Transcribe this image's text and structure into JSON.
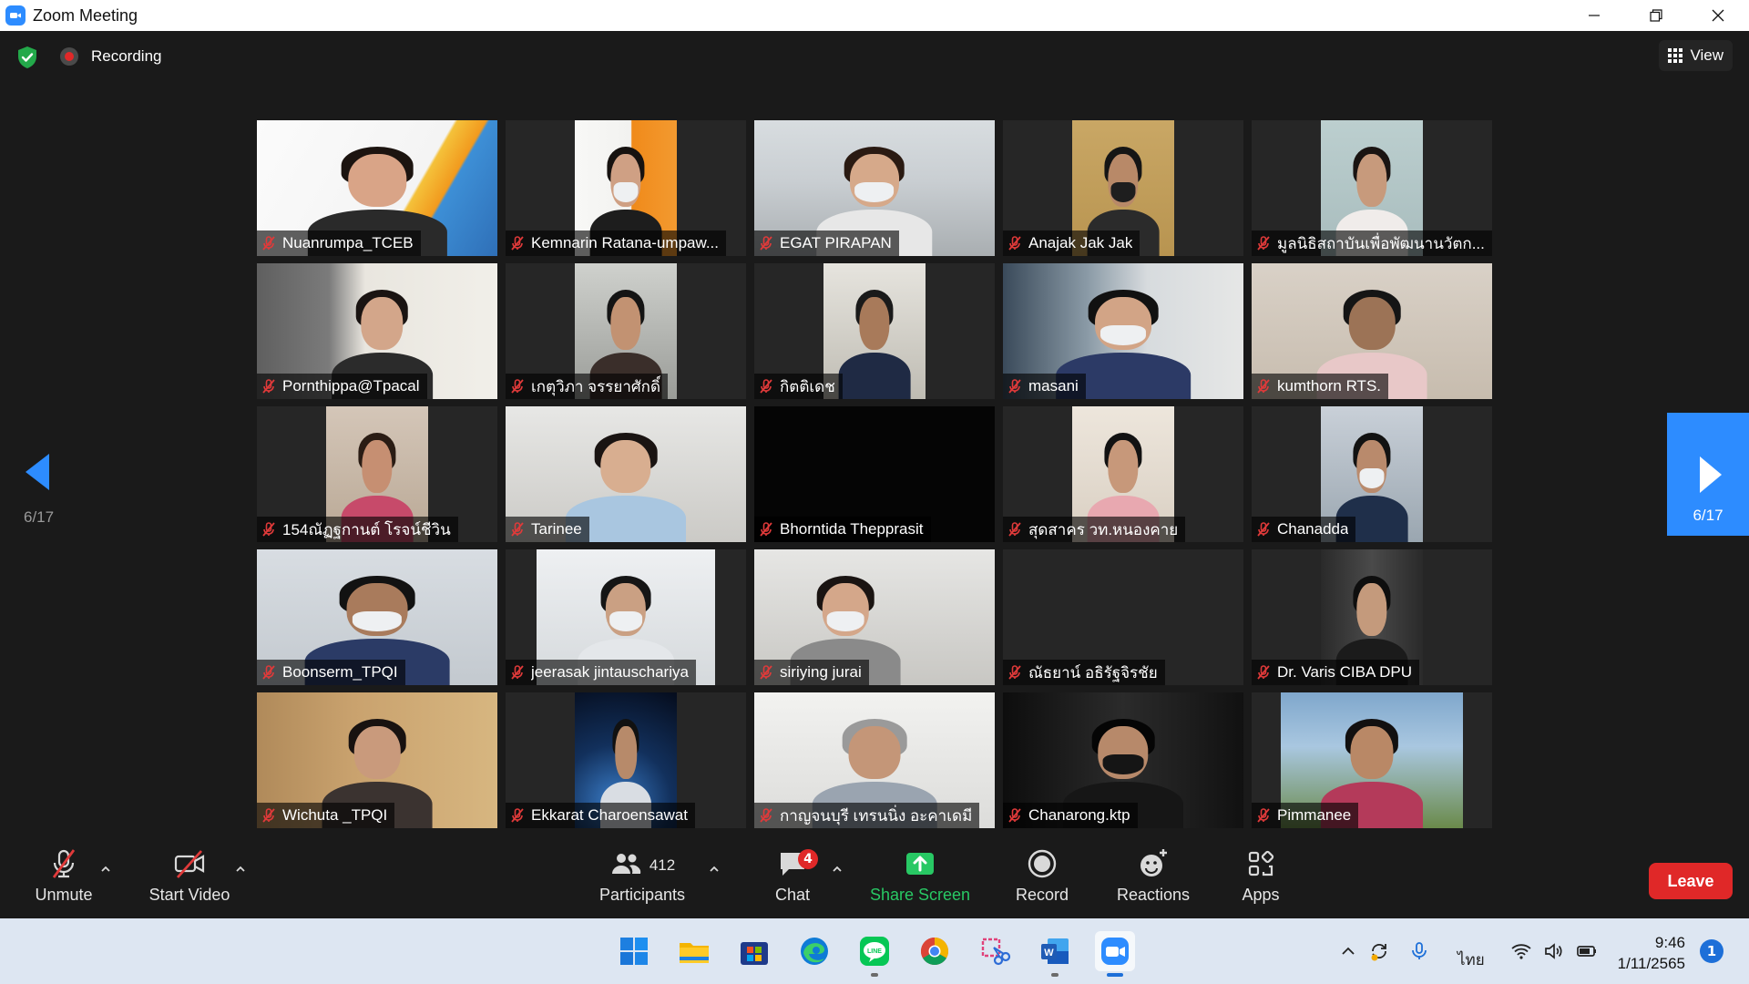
{
  "window": {
    "title": "Zoom Meeting"
  },
  "topbar": {
    "recording_label": "Recording",
    "view_label": "View"
  },
  "pages": {
    "prev_label": "6/17",
    "next_label": "6/17"
  },
  "participants_tiles": [
    {
      "name": "Nuanrumpa_TCEB",
      "muted": true
    },
    {
      "name": "Kemnarin Ratana-umpaw...",
      "muted": true
    },
    {
      "name": "EGAT PIRAPAN",
      "muted": true
    },
    {
      "name": "Anajak Jak Jak",
      "muted": true
    },
    {
      "name": "มูลนิธิสถาบันเพื่อพัฒนานวัตก...",
      "muted": true
    },
    {
      "name": "Pornthippa@Tpacal",
      "muted": true
    },
    {
      "name": "เกตุวิภา จรรยาศักดิ์",
      "muted": true
    },
    {
      "name": "กิตติเดช",
      "muted": true
    },
    {
      "name": "masani",
      "muted": true
    },
    {
      "name": "kumthorn RTS.",
      "muted": true
    },
    {
      "name": "154ณัฏฐกานต์ โรจน์ชีวิน",
      "muted": true
    },
    {
      "name": "Tarinee",
      "muted": true
    },
    {
      "name": "Bhorntida Thepprasit",
      "muted": true
    },
    {
      "name": "สุดสาคร วท.หนองคาย",
      "muted": true
    },
    {
      "name": "Chanadda",
      "muted": true
    },
    {
      "name": "Boonserm_TPQI",
      "muted": true
    },
    {
      "name": "jeerasak jintauschariya",
      "muted": true
    },
    {
      "name": "siriying jurai",
      "muted": true
    },
    {
      "name": "ณัธยาน์ อธิรัฐจิรชัย",
      "muted": true
    },
    {
      "name": "Dr. Varis CIBA DPU",
      "muted": true
    },
    {
      "name": "Wichuta _TPQI",
      "muted": true
    },
    {
      "name": "Ekkarat Charoensawat",
      "muted": true
    },
    {
      "name": "กาญจนบุรี เทรนนิ่ง อะคาเดมี",
      "muted": true
    },
    {
      "name": "Chanarong.ktp",
      "muted": true
    },
    {
      "name": "Pimmanee",
      "muted": true
    }
  ],
  "toolbar": {
    "unmute": "Unmute",
    "start_video": "Start Video",
    "participants": "Participants",
    "participants_count": "412",
    "chat": "Chat",
    "chat_badge": "4",
    "share_screen": "Share Screen",
    "record": "Record",
    "reactions": "Reactions",
    "apps": "Apps",
    "leave": "Leave"
  },
  "taskbar": {
    "apps": [
      "start-icon",
      "file-explorer-icon",
      "microsoft-store-icon",
      "edge-icon",
      "line-icon",
      "chrome-icon",
      "snipping-tool-icon",
      "word-icon",
      "zoom-icon"
    ],
    "language": "ไทย",
    "time": "9:46",
    "date": "1/11/2565",
    "notification_count": "1"
  },
  "colors": {
    "zoom_blue": "#2d8cff",
    "leave_red": "#e02828",
    "share_green": "#28c864",
    "mute_red": "#e03a3a"
  }
}
